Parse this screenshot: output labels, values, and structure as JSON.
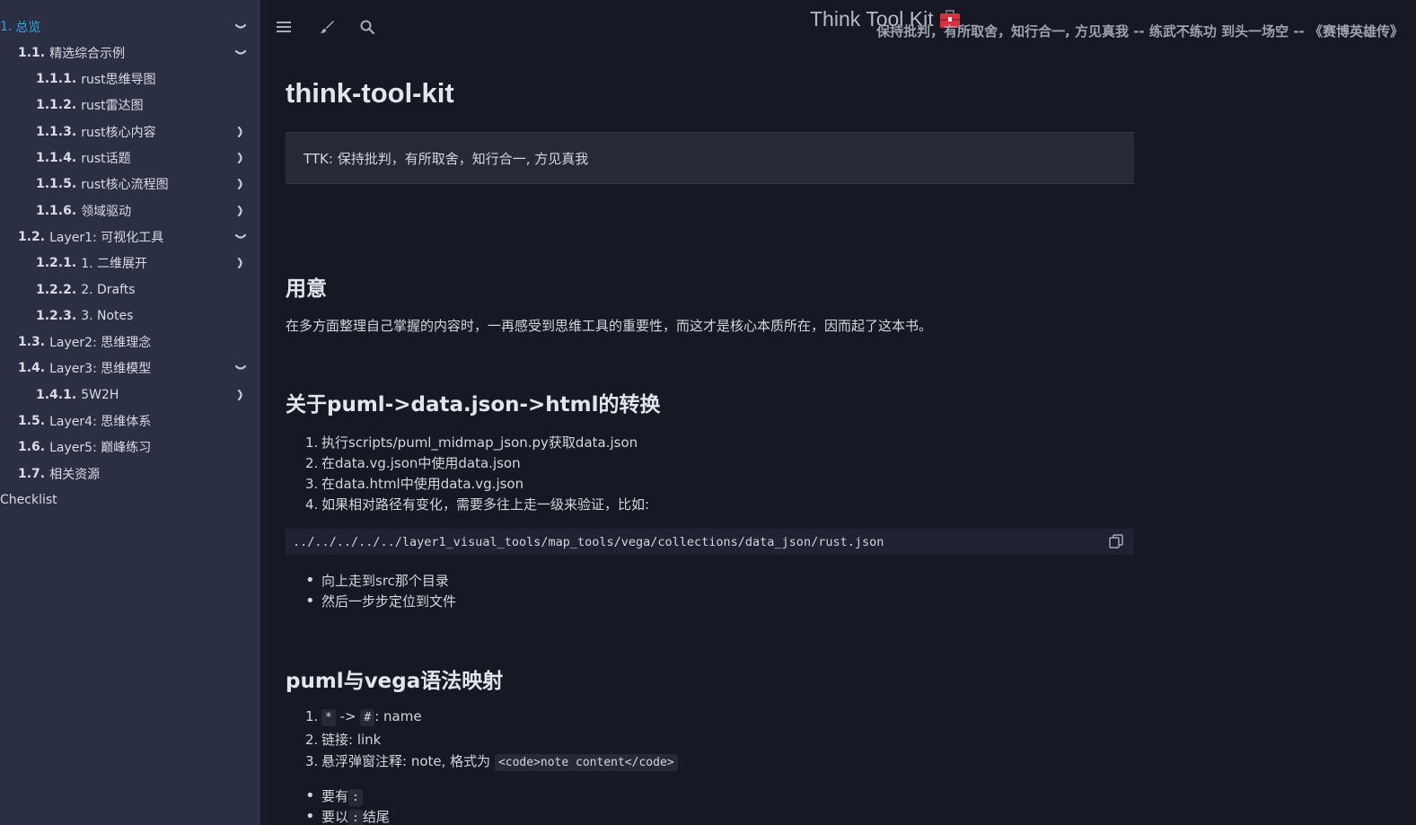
{
  "sidebar": {
    "items": [
      {
        "num": "1.",
        "label": "总览",
        "toggle": "down",
        "active": true
      },
      {
        "num": "1.1.",
        "label": "精选综合示例",
        "toggle": "down"
      },
      {
        "num": "1.1.1.",
        "label": "rust思维导图",
        "toggle": ""
      },
      {
        "num": "1.1.2.",
        "label": "rust雷达图",
        "toggle": ""
      },
      {
        "num": "1.1.3.",
        "label": "rust核心内容",
        "toggle": "right"
      },
      {
        "num": "1.1.4.",
        "label": "rust话题",
        "toggle": "right"
      },
      {
        "num": "1.1.5.",
        "label": "rust核心流程图",
        "toggle": "right"
      },
      {
        "num": "1.1.6.",
        "label": "领域驱动",
        "toggle": "right"
      },
      {
        "num": "1.2.",
        "label": "Layer1: 可视化工具",
        "toggle": "down"
      },
      {
        "num": "1.2.1.",
        "label": "1. 二维展开",
        "toggle": "right"
      },
      {
        "num": "1.2.2.",
        "label": "2. Drafts",
        "toggle": ""
      },
      {
        "num": "1.2.3.",
        "label": "3. Notes",
        "toggle": ""
      },
      {
        "num": "1.3.",
        "label": "Layer2: 思维理念",
        "toggle": ""
      },
      {
        "num": "1.4.",
        "label": "Layer3: 思维模型",
        "toggle": "down"
      },
      {
        "num": "1.4.1.",
        "label": "5W2H",
        "toggle": "right"
      },
      {
        "num": "1.5.",
        "label": "Layer4: 思维体系",
        "toggle": ""
      },
      {
        "num": "1.6.",
        "label": "Layer5: 巅峰练习",
        "toggle": ""
      },
      {
        "num": "1.7.",
        "label": "相关资源",
        "toggle": ""
      },
      {
        "num": "",
        "label": "Checklist",
        "toggle": ""
      }
    ]
  },
  "header": {
    "title": "Think Tool Kit",
    "motto": "保持批判，有所取舍，知行合一, 方见真我 -- 练武不练功 到头一场空 -- 《赛博英雄传》",
    "icons": [
      "menu-icon",
      "paintbrush-icon",
      "search-icon"
    ]
  },
  "main": {
    "title": "think-tool-kit",
    "quote": "TTK: 保持批判，有所取舍，知行合一, 方见真我",
    "purpose": {
      "heading": "用意",
      "text": "在多方面整理自己掌握的内容时，一再感受到思维工具的重要性，而这才是核心本质所在，因而起了这本书。"
    },
    "conversion": {
      "heading": "关于puml->data.json->html的转换",
      "steps": [
        "执行scripts/puml_midmap_json.py获取data.json",
        "在data.vg.json中使用data.json",
        "在data.html中使用data.vg.json",
        "如果相对路径有变化，需要多往上走一级来验证，比如:"
      ],
      "code": "../../../../../layer1_visual_tools/map_tools/vega/collections/data_json/rust.json",
      "bullets": [
        "向上走到src那个目录",
        "然后一步步定位到文件"
      ]
    },
    "mapping": {
      "heading": "puml与vega语法映射",
      "item1_code_a": "*",
      "item1_arrow": "->",
      "item1_code_b": "#",
      "item1_rest": ": name",
      "item2": "链接: link",
      "item3_text": "悬浮弹窗注释: note, 格式为",
      "item3_code": "<code>note content</code>",
      "bullet1_text": "要有",
      "bullet1_code": ":",
      "bullet2_text": "要以",
      "bullet2_code": ":",
      "bullet2_rest": "结尾"
    }
  }
}
